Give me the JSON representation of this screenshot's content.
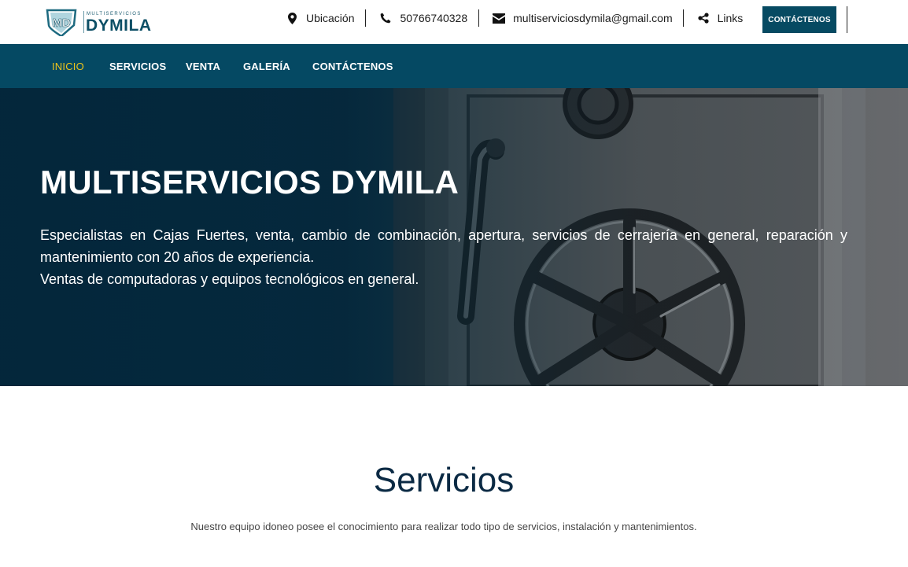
{
  "brand": {
    "badge_text": "MD",
    "subtitle": "MULTISERVICIOS",
    "name": "DYMILA"
  },
  "topbar": {
    "location": {
      "label": "Ubicación",
      "icon": "map-marker-icon"
    },
    "phone": {
      "label": "50766740328",
      "icon": "phone-icon"
    },
    "email": {
      "label": "multiserviciosdymila@gmail.com",
      "icon": "envelope-icon"
    },
    "links": {
      "label": "Links",
      "icon": "share-icon"
    },
    "cta_label": "CONTÁCTENOS"
  },
  "nav": {
    "items": [
      {
        "label": "INICIO",
        "active": true
      },
      {
        "label": "SERVICIOS"
      },
      {
        "label": "VENTA"
      },
      {
        "label": "GALERÍA"
      },
      {
        "label": "CONTÁCTENOS"
      }
    ]
  },
  "hero": {
    "title": "MULTISERVICIOS DYMILA",
    "paragraph_1": "Especialistas en Cajas Fuertes, venta, cambio de combinación, apertura, servicios de cerrajería en general, reparación y mantenimiento con 20 años de experiencia.",
    "paragraph_2": "Ventas de computadoras y equipos tecnológicos en general."
  },
  "services": {
    "title": "Servicios",
    "description": "Nuestro equipo idoneo posee el conocimiento para realizar todo tipo de servicios, instalación y mantenimientos."
  },
  "colors": {
    "primary": "#054963",
    "active_nav": "#f0c419",
    "heading": "#0b2a44"
  }
}
